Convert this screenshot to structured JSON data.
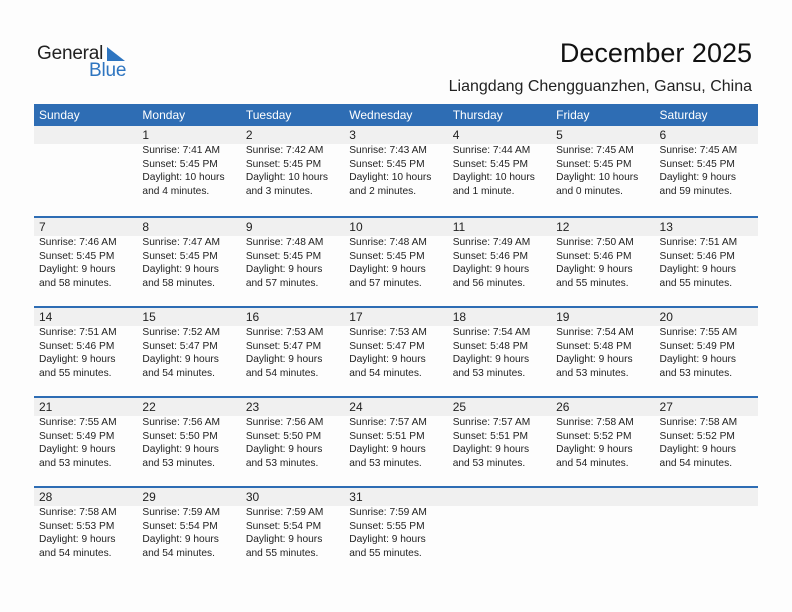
{
  "logo": {
    "general": "General",
    "blue": "Blue"
  },
  "header": {
    "title": "December 2025",
    "location": "Liangdang Chengguanzhen, Gansu, China"
  },
  "colors": {
    "accent": "#2E6DB4",
    "strip": "#F0F0F0"
  },
  "weekdays": [
    "Sunday",
    "Monday",
    "Tuesday",
    "Wednesday",
    "Thursday",
    "Friday",
    "Saturday"
  ],
  "weeks": [
    [
      null,
      {
        "day": "1",
        "sunrise": "Sunrise: 7:41 AM",
        "sunset": "Sunset: 5:45 PM",
        "daylight1": "Daylight: 10 hours",
        "daylight2": "and 4 minutes."
      },
      {
        "day": "2",
        "sunrise": "Sunrise: 7:42 AM",
        "sunset": "Sunset: 5:45 PM",
        "daylight1": "Daylight: 10 hours",
        "daylight2": "and 3 minutes."
      },
      {
        "day": "3",
        "sunrise": "Sunrise: 7:43 AM",
        "sunset": "Sunset: 5:45 PM",
        "daylight1": "Daylight: 10 hours",
        "daylight2": "and 2 minutes."
      },
      {
        "day": "4",
        "sunrise": "Sunrise: 7:44 AM",
        "sunset": "Sunset: 5:45 PM",
        "daylight1": "Daylight: 10 hours",
        "daylight2": "and 1 minute."
      },
      {
        "day": "5",
        "sunrise": "Sunrise: 7:45 AM",
        "sunset": "Sunset: 5:45 PM",
        "daylight1": "Daylight: 10 hours",
        "daylight2": "and 0 minutes."
      },
      {
        "day": "6",
        "sunrise": "Sunrise: 7:45 AM",
        "sunset": "Sunset: 5:45 PM",
        "daylight1": "Daylight: 9 hours",
        "daylight2": "and 59 minutes."
      }
    ],
    [
      {
        "day": "7",
        "sunrise": "Sunrise: 7:46 AM",
        "sunset": "Sunset: 5:45 PM",
        "daylight1": "Daylight: 9 hours",
        "daylight2": "and 58 minutes."
      },
      {
        "day": "8",
        "sunrise": "Sunrise: 7:47 AM",
        "sunset": "Sunset: 5:45 PM",
        "daylight1": "Daylight: 9 hours",
        "daylight2": "and 58 minutes."
      },
      {
        "day": "9",
        "sunrise": "Sunrise: 7:48 AM",
        "sunset": "Sunset: 5:45 PM",
        "daylight1": "Daylight: 9 hours",
        "daylight2": "and 57 minutes."
      },
      {
        "day": "10",
        "sunrise": "Sunrise: 7:48 AM",
        "sunset": "Sunset: 5:45 PM",
        "daylight1": "Daylight: 9 hours",
        "daylight2": "and 57 minutes."
      },
      {
        "day": "11",
        "sunrise": "Sunrise: 7:49 AM",
        "sunset": "Sunset: 5:46 PM",
        "daylight1": "Daylight: 9 hours",
        "daylight2": "and 56 minutes."
      },
      {
        "day": "12",
        "sunrise": "Sunrise: 7:50 AM",
        "sunset": "Sunset: 5:46 PM",
        "daylight1": "Daylight: 9 hours",
        "daylight2": "and 55 minutes."
      },
      {
        "day": "13",
        "sunrise": "Sunrise: 7:51 AM",
        "sunset": "Sunset: 5:46 PM",
        "daylight1": "Daylight: 9 hours",
        "daylight2": "and 55 minutes."
      }
    ],
    [
      {
        "day": "14",
        "sunrise": "Sunrise: 7:51 AM",
        "sunset": "Sunset: 5:46 PM",
        "daylight1": "Daylight: 9 hours",
        "daylight2": "and 55 minutes."
      },
      {
        "day": "15",
        "sunrise": "Sunrise: 7:52 AM",
        "sunset": "Sunset: 5:47 PM",
        "daylight1": "Daylight: 9 hours",
        "daylight2": "and 54 minutes."
      },
      {
        "day": "16",
        "sunrise": "Sunrise: 7:53 AM",
        "sunset": "Sunset: 5:47 PM",
        "daylight1": "Daylight: 9 hours",
        "daylight2": "and 54 minutes."
      },
      {
        "day": "17",
        "sunrise": "Sunrise: 7:53 AM",
        "sunset": "Sunset: 5:47 PM",
        "daylight1": "Daylight: 9 hours",
        "daylight2": "and 54 minutes."
      },
      {
        "day": "18",
        "sunrise": "Sunrise: 7:54 AM",
        "sunset": "Sunset: 5:48 PM",
        "daylight1": "Daylight: 9 hours",
        "daylight2": "and 53 minutes."
      },
      {
        "day": "19",
        "sunrise": "Sunrise: 7:54 AM",
        "sunset": "Sunset: 5:48 PM",
        "daylight1": "Daylight: 9 hours",
        "daylight2": "and 53 minutes."
      },
      {
        "day": "20",
        "sunrise": "Sunrise: 7:55 AM",
        "sunset": "Sunset: 5:49 PM",
        "daylight1": "Daylight: 9 hours",
        "daylight2": "and 53 minutes."
      }
    ],
    [
      {
        "day": "21",
        "sunrise": "Sunrise: 7:55 AM",
        "sunset": "Sunset: 5:49 PM",
        "daylight1": "Daylight: 9 hours",
        "daylight2": "and 53 minutes."
      },
      {
        "day": "22",
        "sunrise": "Sunrise: 7:56 AM",
        "sunset": "Sunset: 5:50 PM",
        "daylight1": "Daylight: 9 hours",
        "daylight2": "and 53 minutes."
      },
      {
        "day": "23",
        "sunrise": "Sunrise: 7:56 AM",
        "sunset": "Sunset: 5:50 PM",
        "daylight1": "Daylight: 9 hours",
        "daylight2": "and 53 minutes."
      },
      {
        "day": "24",
        "sunrise": "Sunrise: 7:57 AM",
        "sunset": "Sunset: 5:51 PM",
        "daylight1": "Daylight: 9 hours",
        "daylight2": "and 53 minutes."
      },
      {
        "day": "25",
        "sunrise": "Sunrise: 7:57 AM",
        "sunset": "Sunset: 5:51 PM",
        "daylight1": "Daylight: 9 hours",
        "daylight2": "and 53 minutes."
      },
      {
        "day": "26",
        "sunrise": "Sunrise: 7:58 AM",
        "sunset": "Sunset: 5:52 PM",
        "daylight1": "Daylight: 9 hours",
        "daylight2": "and 54 minutes."
      },
      {
        "day": "27",
        "sunrise": "Sunrise: 7:58 AM",
        "sunset": "Sunset: 5:52 PM",
        "daylight1": "Daylight: 9 hours",
        "daylight2": "and 54 minutes."
      }
    ],
    [
      {
        "day": "28",
        "sunrise": "Sunrise: 7:58 AM",
        "sunset": "Sunset: 5:53 PM",
        "daylight1": "Daylight: 9 hours",
        "daylight2": "and 54 minutes."
      },
      {
        "day": "29",
        "sunrise": "Sunrise: 7:59 AM",
        "sunset": "Sunset: 5:54 PM",
        "daylight1": "Daylight: 9 hours",
        "daylight2": "and 54 minutes."
      },
      {
        "day": "30",
        "sunrise": "Sunrise: 7:59 AM",
        "sunset": "Sunset: 5:54 PM",
        "daylight1": "Daylight: 9 hours",
        "daylight2": "and 55 minutes."
      },
      {
        "day": "31",
        "sunrise": "Sunrise: 7:59 AM",
        "sunset": "Sunset: 5:55 PM",
        "daylight1": "Daylight: 9 hours",
        "daylight2": "and 55 minutes."
      },
      null,
      null,
      null
    ]
  ]
}
